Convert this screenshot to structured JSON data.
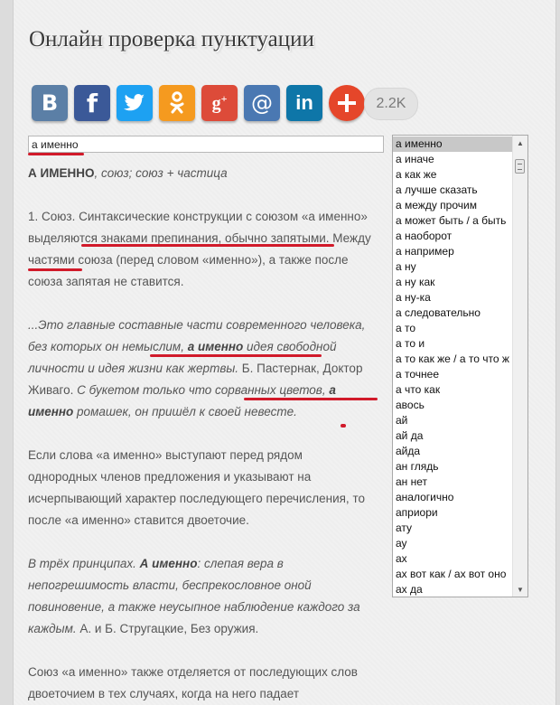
{
  "page": {
    "title": "Онлайн проверка пунктуации"
  },
  "share": {
    "buttons": [
      {
        "name": "vk-button",
        "glyph": "B",
        "color": "#5b7fa6"
      },
      {
        "name": "facebook-button",
        "glyph": "f",
        "color": "#3b5998"
      },
      {
        "name": "twitter-button",
        "glyph": "twitter-bird",
        "color": "#1da1f2"
      },
      {
        "name": "odnoklassniki-button",
        "glyph": "ok-figure",
        "color": "#f59a1f"
      },
      {
        "name": "googleplus-button",
        "glyph": "g+",
        "color": "#dd4b39"
      },
      {
        "name": "mail-button",
        "glyph": "@",
        "color": "#4a78b2"
      },
      {
        "name": "linkedin-button",
        "glyph": "in",
        "color": "#0e76a8"
      },
      {
        "name": "more-button",
        "glyph": "+",
        "color": "#e5462a"
      }
    ],
    "count": "2.2K"
  },
  "search": {
    "value": "а именно"
  },
  "list": {
    "selected_index": 0,
    "items": [
      "а именно",
      "а иначе",
      "а как же",
      "а лучше сказать",
      "а между прочим",
      "а может быть / а быть",
      "а наоборот",
      "а например",
      "а ну",
      "а ну как",
      "а ну-ка",
      "а следовательно",
      "а то",
      "а то и",
      "а то как же / а то что ж",
      "а точнее",
      "а что как",
      "авось",
      "ай",
      "ай да",
      "айда",
      "ан глядь",
      "ан нет",
      "аналогично",
      "априори",
      "ату",
      "ау",
      "ах",
      "ах вот как / ах вот оно",
      "ах да"
    ]
  },
  "article": {
    "def_head": "А ИМЕННО",
    "def_text": ", союз; союз + частица",
    "p1_a": "1. Союз. Синтаксические конструкции с союзом «а именно» выделяются знаками препинания, обычно запятыми",
    "p1_b": ". Между частями союза (перед словом «именно»), а также после союза запятая не ставится.",
    "p2_a": "...Это главные составные части современного человека, без которых он немыслим, ",
    "p2_kw1": "а именно",
    "p2_b": " идея свободной личности и идея жизни как жертвы.",
    "p2_src1": " Б. Пастернак, Доктор Живаго.",
    "p2_c": " С букетом только что сорванных цветов, ",
    "p2_kw2": "а именно",
    "p2_d": " ромашек, он пришёл к своей невесте.",
    "p3": "Если слова «а именно» выступают перед рядом однородных членов предложения и указывают на исчерпывающий характер последующего перечисления, то после «а именно» ставится двоеточие.",
    "p4_a": "В трёх принципах. ",
    "p4_kw": "А именно",
    "p4_b": ": слепая вера в непогрешимость власти, беспрекословное оной повиновение, а также неусыпное наблюдение каждого за каждым.",
    "p4_src": " А. и Б. Стругацкие, Без оружия.",
    "p5": "Союз «а именно» также отделяется от последующих слов двоеточием в тех случаях, когда на него падает"
  }
}
